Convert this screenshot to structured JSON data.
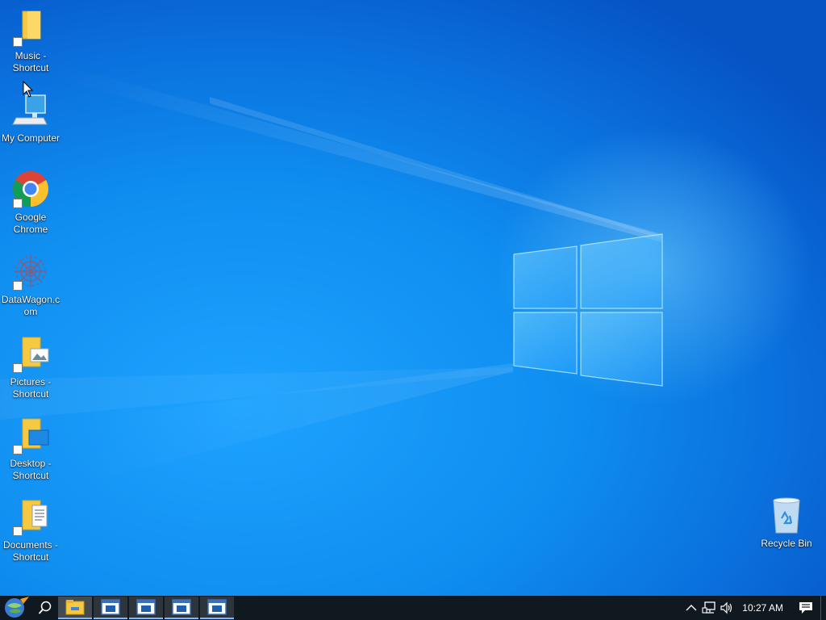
{
  "desktop": {
    "icons": [
      {
        "label": "Music -\nShortcut",
        "icon": "music-folder-icon"
      },
      {
        "label": "My Computer",
        "icon": "computer-icon"
      },
      {
        "label": "Google\nChrome",
        "icon": "chrome-icon"
      },
      {
        "label": "DataWagon.c\nom",
        "icon": "datawagon-icon"
      },
      {
        "label": "Pictures -\nShortcut",
        "icon": "pictures-folder-icon"
      },
      {
        "label": "Desktop -\nShortcut",
        "icon": "desktop-folder-icon"
      },
      {
        "label": "Documents -\nShortcut",
        "icon": "documents-folder-icon"
      },
      {
        "label": "Recycle Bin",
        "icon": "recycle-bin-icon"
      }
    ]
  },
  "taskbar": {
    "clock": "10:27 AM",
    "apps": [
      {
        "icon": "file-explorer-icon"
      },
      {
        "icon": "window-icon"
      },
      {
        "icon": "window-icon"
      },
      {
        "icon": "window-icon"
      },
      {
        "icon": "window-icon"
      }
    ]
  },
  "colors": {
    "desktop_blue": "#0f8ef0",
    "taskbar": "#101820",
    "folder_yellow": "#f6c942"
  }
}
